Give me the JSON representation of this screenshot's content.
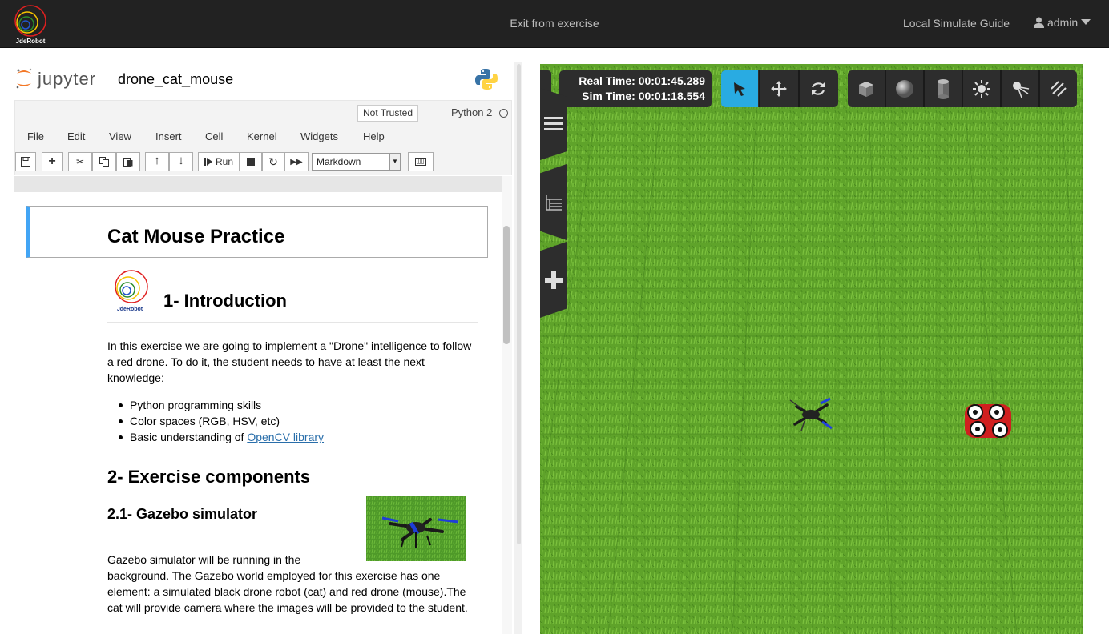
{
  "header": {
    "logo_text": "JdeRobot",
    "exit_label": "Exit from exercise",
    "guide_label": "Local Simulate Guide",
    "user_label": "admin"
  },
  "jupyter": {
    "brand": "jupyter",
    "notebook_name": "drone_cat_mouse",
    "trusted_label": "Not Trusted",
    "kernel_label": "Python 2",
    "menu": [
      "File",
      "Edit",
      "View",
      "Insert",
      "Cell",
      "Kernel",
      "Widgets",
      "Help"
    ],
    "run_label": "Run",
    "cell_type": "Markdown"
  },
  "notebook": {
    "title": "Cat Mouse Practice",
    "logo_text": "JdeRobot",
    "intro_heading": "1- Introduction",
    "intro_lines": [
      "In this exercise we are going to implement a \"Drone\" intelligence to follow",
      "a red drone. To do it, the student needs to have at least the next",
      "knowledge:"
    ],
    "bullets": [
      "Python programming skills",
      "Color spaces (RGB, HSV, etc)"
    ],
    "bullet3_text": "Basic understanding of ",
    "bullet3_link": "OpenCV library",
    "components_heading": "2- Exercise components",
    "gazebo_heading": "2.1- Gazebo simulator",
    "gazebo_lines": [
      "Gazebo simulator will be running in the",
      "background. The Gazebo world employed for this exercise has one",
      "element: a simulated black drone robot (cat) and red drone (mouse).The",
      "cat will provide camera where the images will be provided to the student."
    ]
  },
  "gazebo": {
    "real_time": "Real Time: 00:01:45.289",
    "sim_time": "Sim Time: 00:01:18.554",
    "tools": [
      "select-arrow",
      "translate",
      "rotate",
      "box",
      "sphere",
      "cylinder",
      "point-light",
      "spot-light",
      "directional-light"
    ],
    "active_tool": "select-arrow",
    "accent_color": "#29abe2",
    "ground_color": "#5fa32a"
  }
}
